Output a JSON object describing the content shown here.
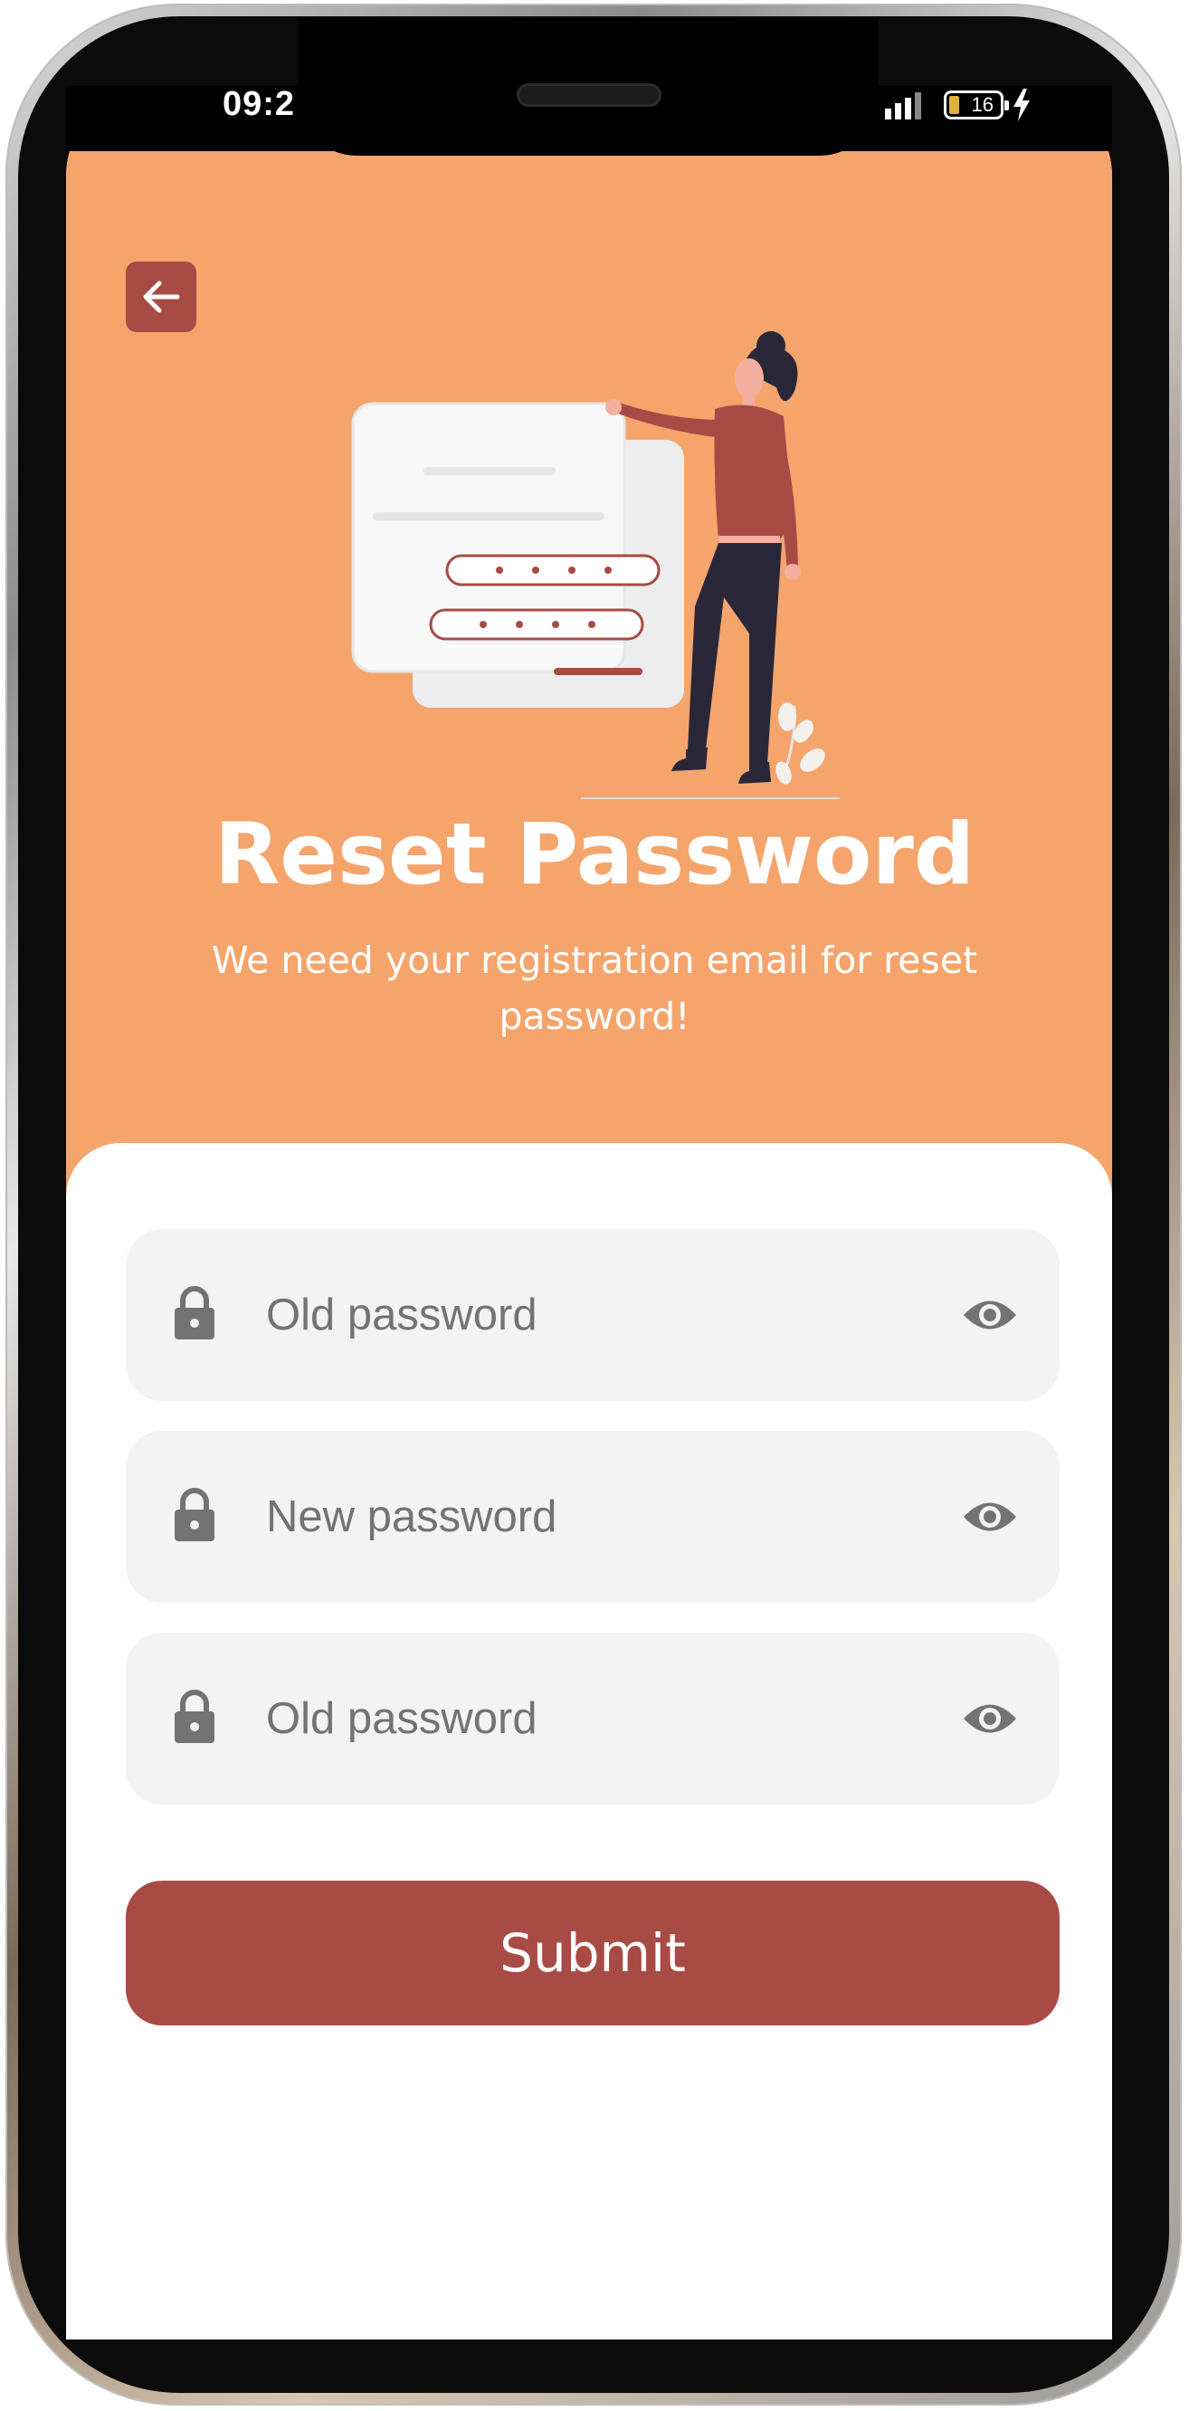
{
  "status_bar": {
    "time": "09:2",
    "battery": "16"
  },
  "header": {
    "title": "Reset Password",
    "subtitle": "We need your registration email for reset password!"
  },
  "form": {
    "fields": [
      {
        "placeholder": "Old password",
        "icon": "lock-icon",
        "toggle_icon": "eye-icon"
      },
      {
        "placeholder": "New password",
        "icon": "lock-icon",
        "toggle_icon": "eye-icon"
      },
      {
        "placeholder": "Old password",
        "icon": "lock-icon",
        "toggle_icon": "eye-icon"
      }
    ],
    "submit_label": "Submit"
  },
  "colors": {
    "header_bg": "#f5a46c",
    "accent": "#a84b45",
    "field_bg": "#f3f3f3",
    "placeholder_text": "#737373"
  }
}
